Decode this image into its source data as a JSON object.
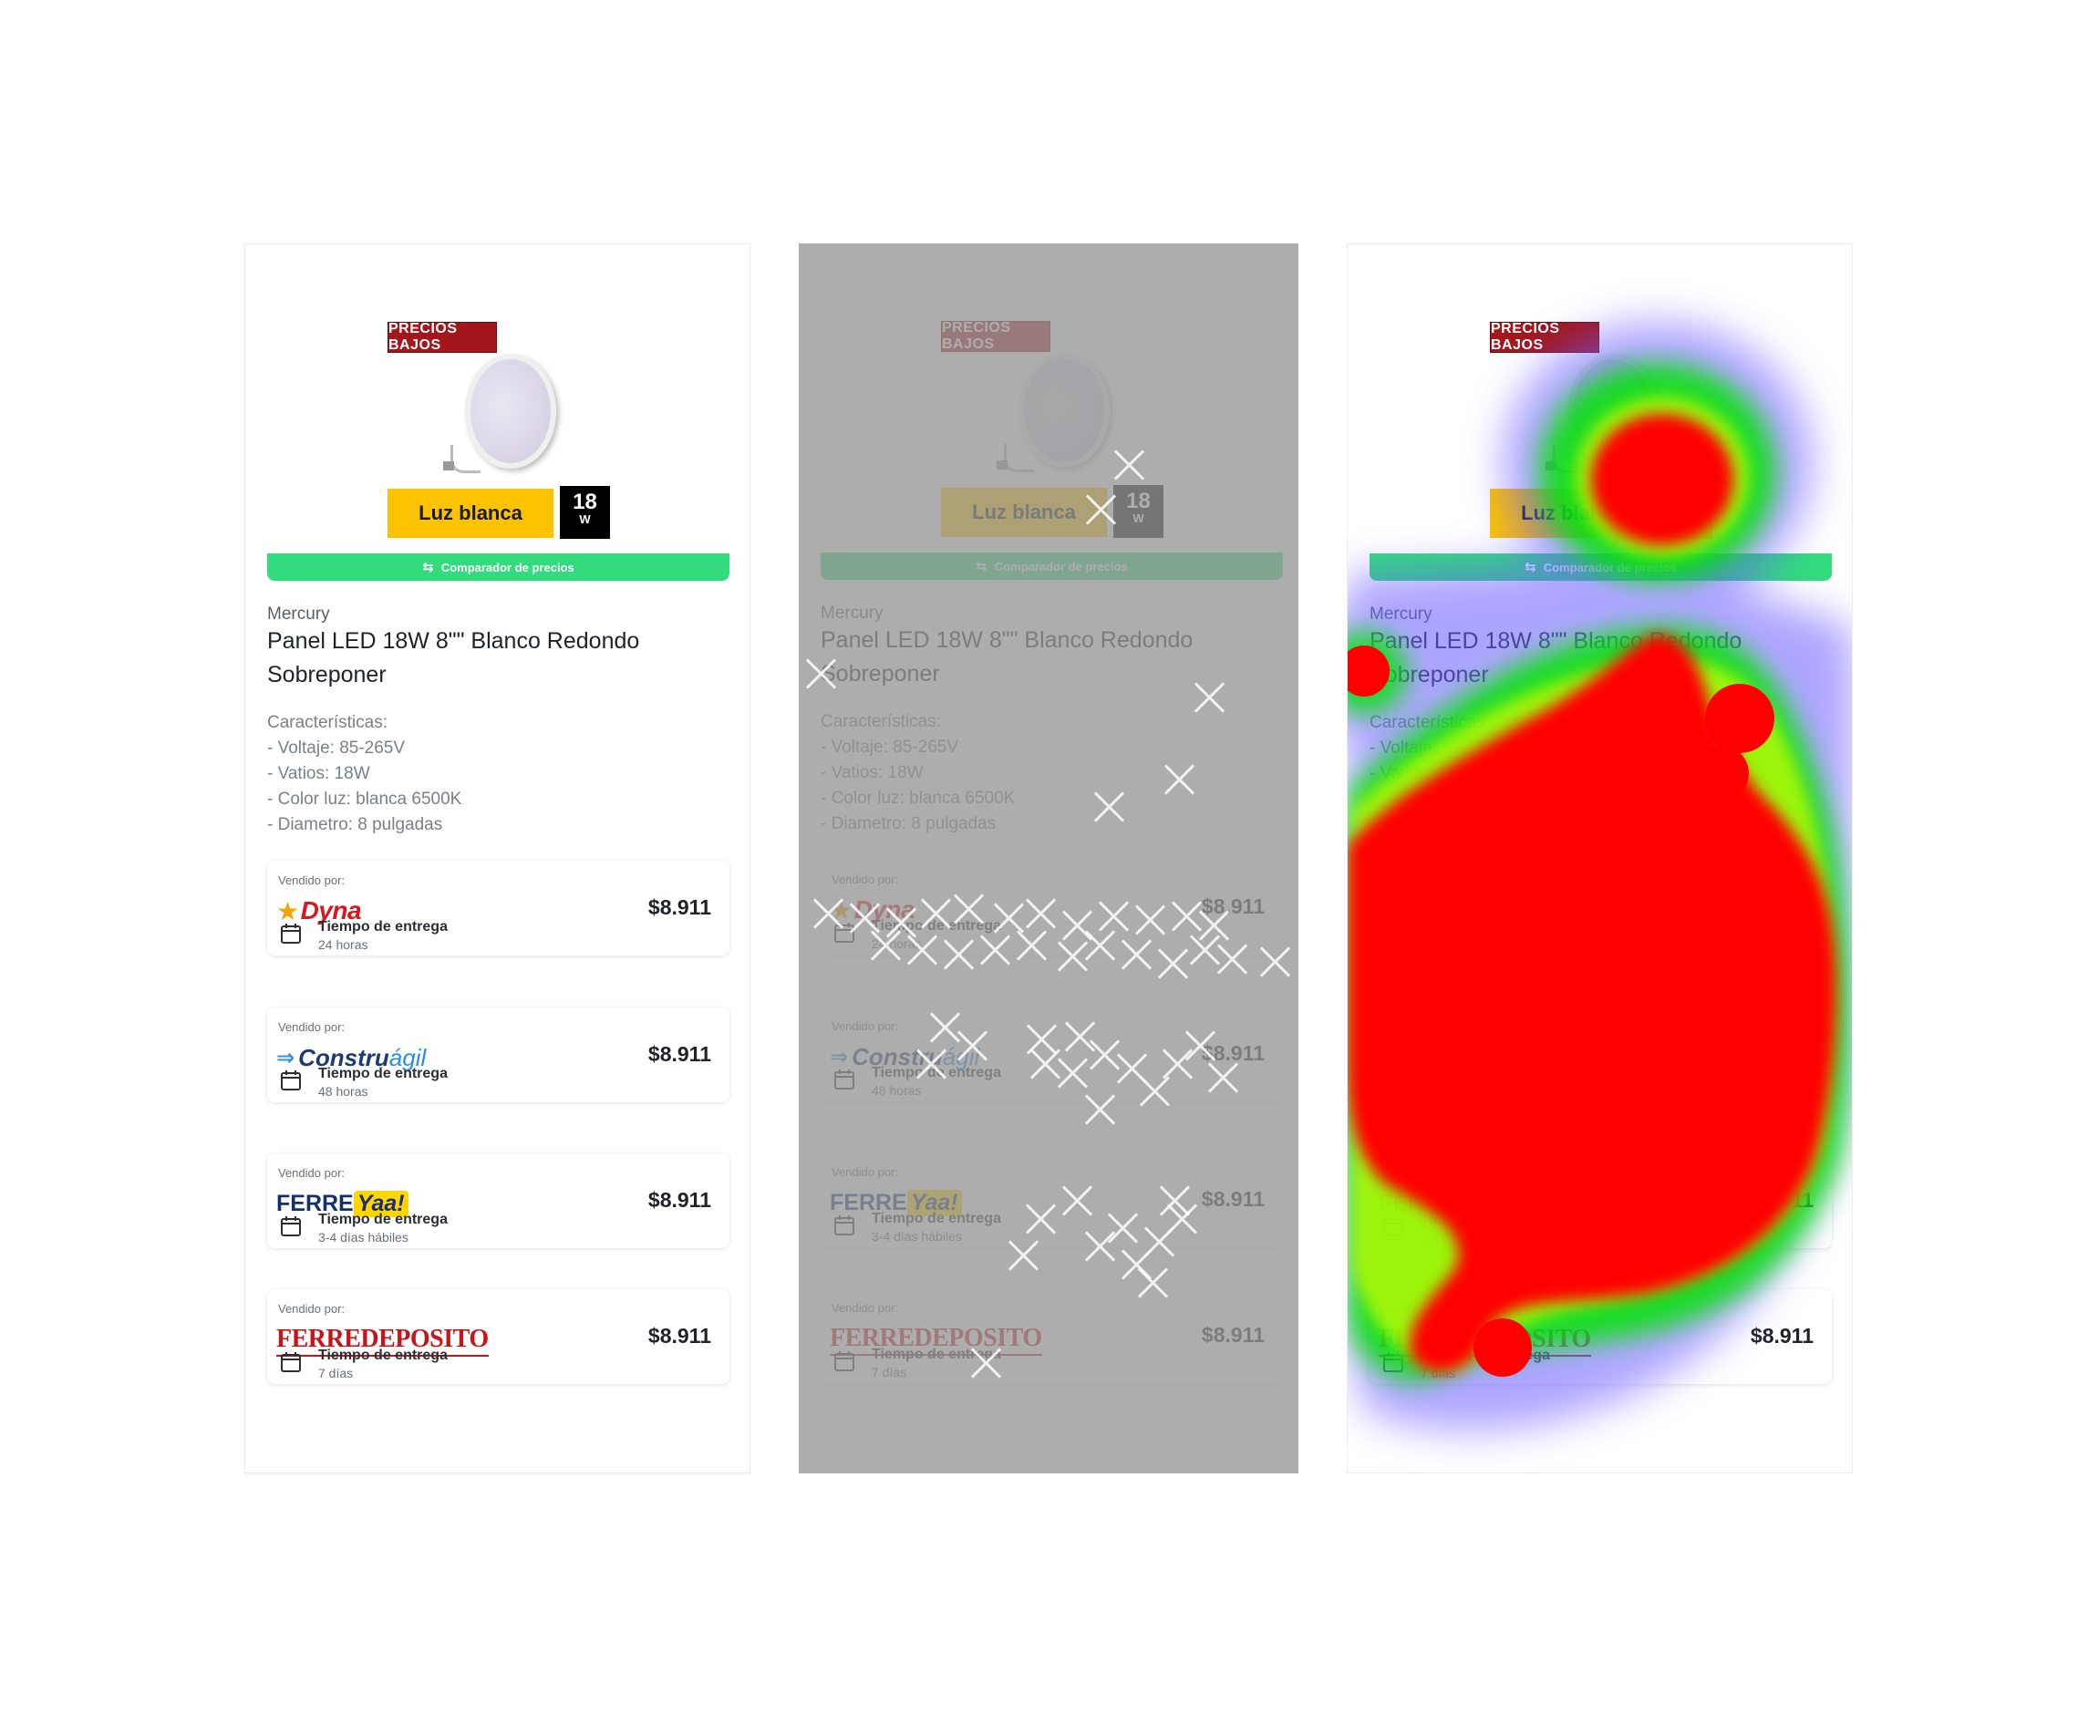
{
  "product": {
    "badge": "PRECIOS BAJOS",
    "luz_label": "Luz blanca",
    "watt_number": "18",
    "watt_unit": "W",
    "compare_label": "Comparador de precios",
    "brand": "Mercury",
    "title": "Panel LED 18W 8\"\" Blanco Redondo Sobreponer",
    "features": [
      "Características:",
      "- Voltaje: 85-265V",
      "- Vatios: 18W",
      "- Color luz: blanca 6500K",
      "- Diametro: 8 pulgadas"
    ]
  },
  "sellers": [
    {
      "sold_by": "Vendido por:",
      "logo": "Dyna",
      "delivery_label": "Tiempo de entrega",
      "delivery_value": "24 horas",
      "price": "$8.911"
    },
    {
      "sold_by": "Vendido por:",
      "logo": "Construágil",
      "delivery_label": "Tiempo de entrega",
      "delivery_value": "48 horas",
      "price": "$8.911"
    },
    {
      "sold_by": "Vendido por:",
      "logo": "FERREYaa!",
      "delivery_label": "Tiempo de entrega",
      "delivery_value": "3-4 días hábiles",
      "price": "$8.911"
    },
    {
      "sold_by": "Vendido por:",
      "logo": "FERREDEPOSITO",
      "delivery_label": "Tiempo de entrega",
      "delivery_value": "7 días",
      "price": "$8.911"
    }
  ],
  "logos": {
    "dyna": "Dyna",
    "constru": "Constru",
    "agil": "ágil",
    "ferre": "FERRE",
    "yaa": "Yaa!",
    "ferredeposito": "FERREDEPOSITO"
  },
  "colors": {
    "badge": "#a3161b",
    "luz": "#fdc300",
    "compare": "#32dc7c",
    "heat_hot": "#ff0000",
    "heat_mid": "#00e600",
    "heat_cool": "#6a5cff"
  },
  "icons": [
    "calendar-icon",
    "compare-arrows-icon",
    "star-icon"
  ]
}
